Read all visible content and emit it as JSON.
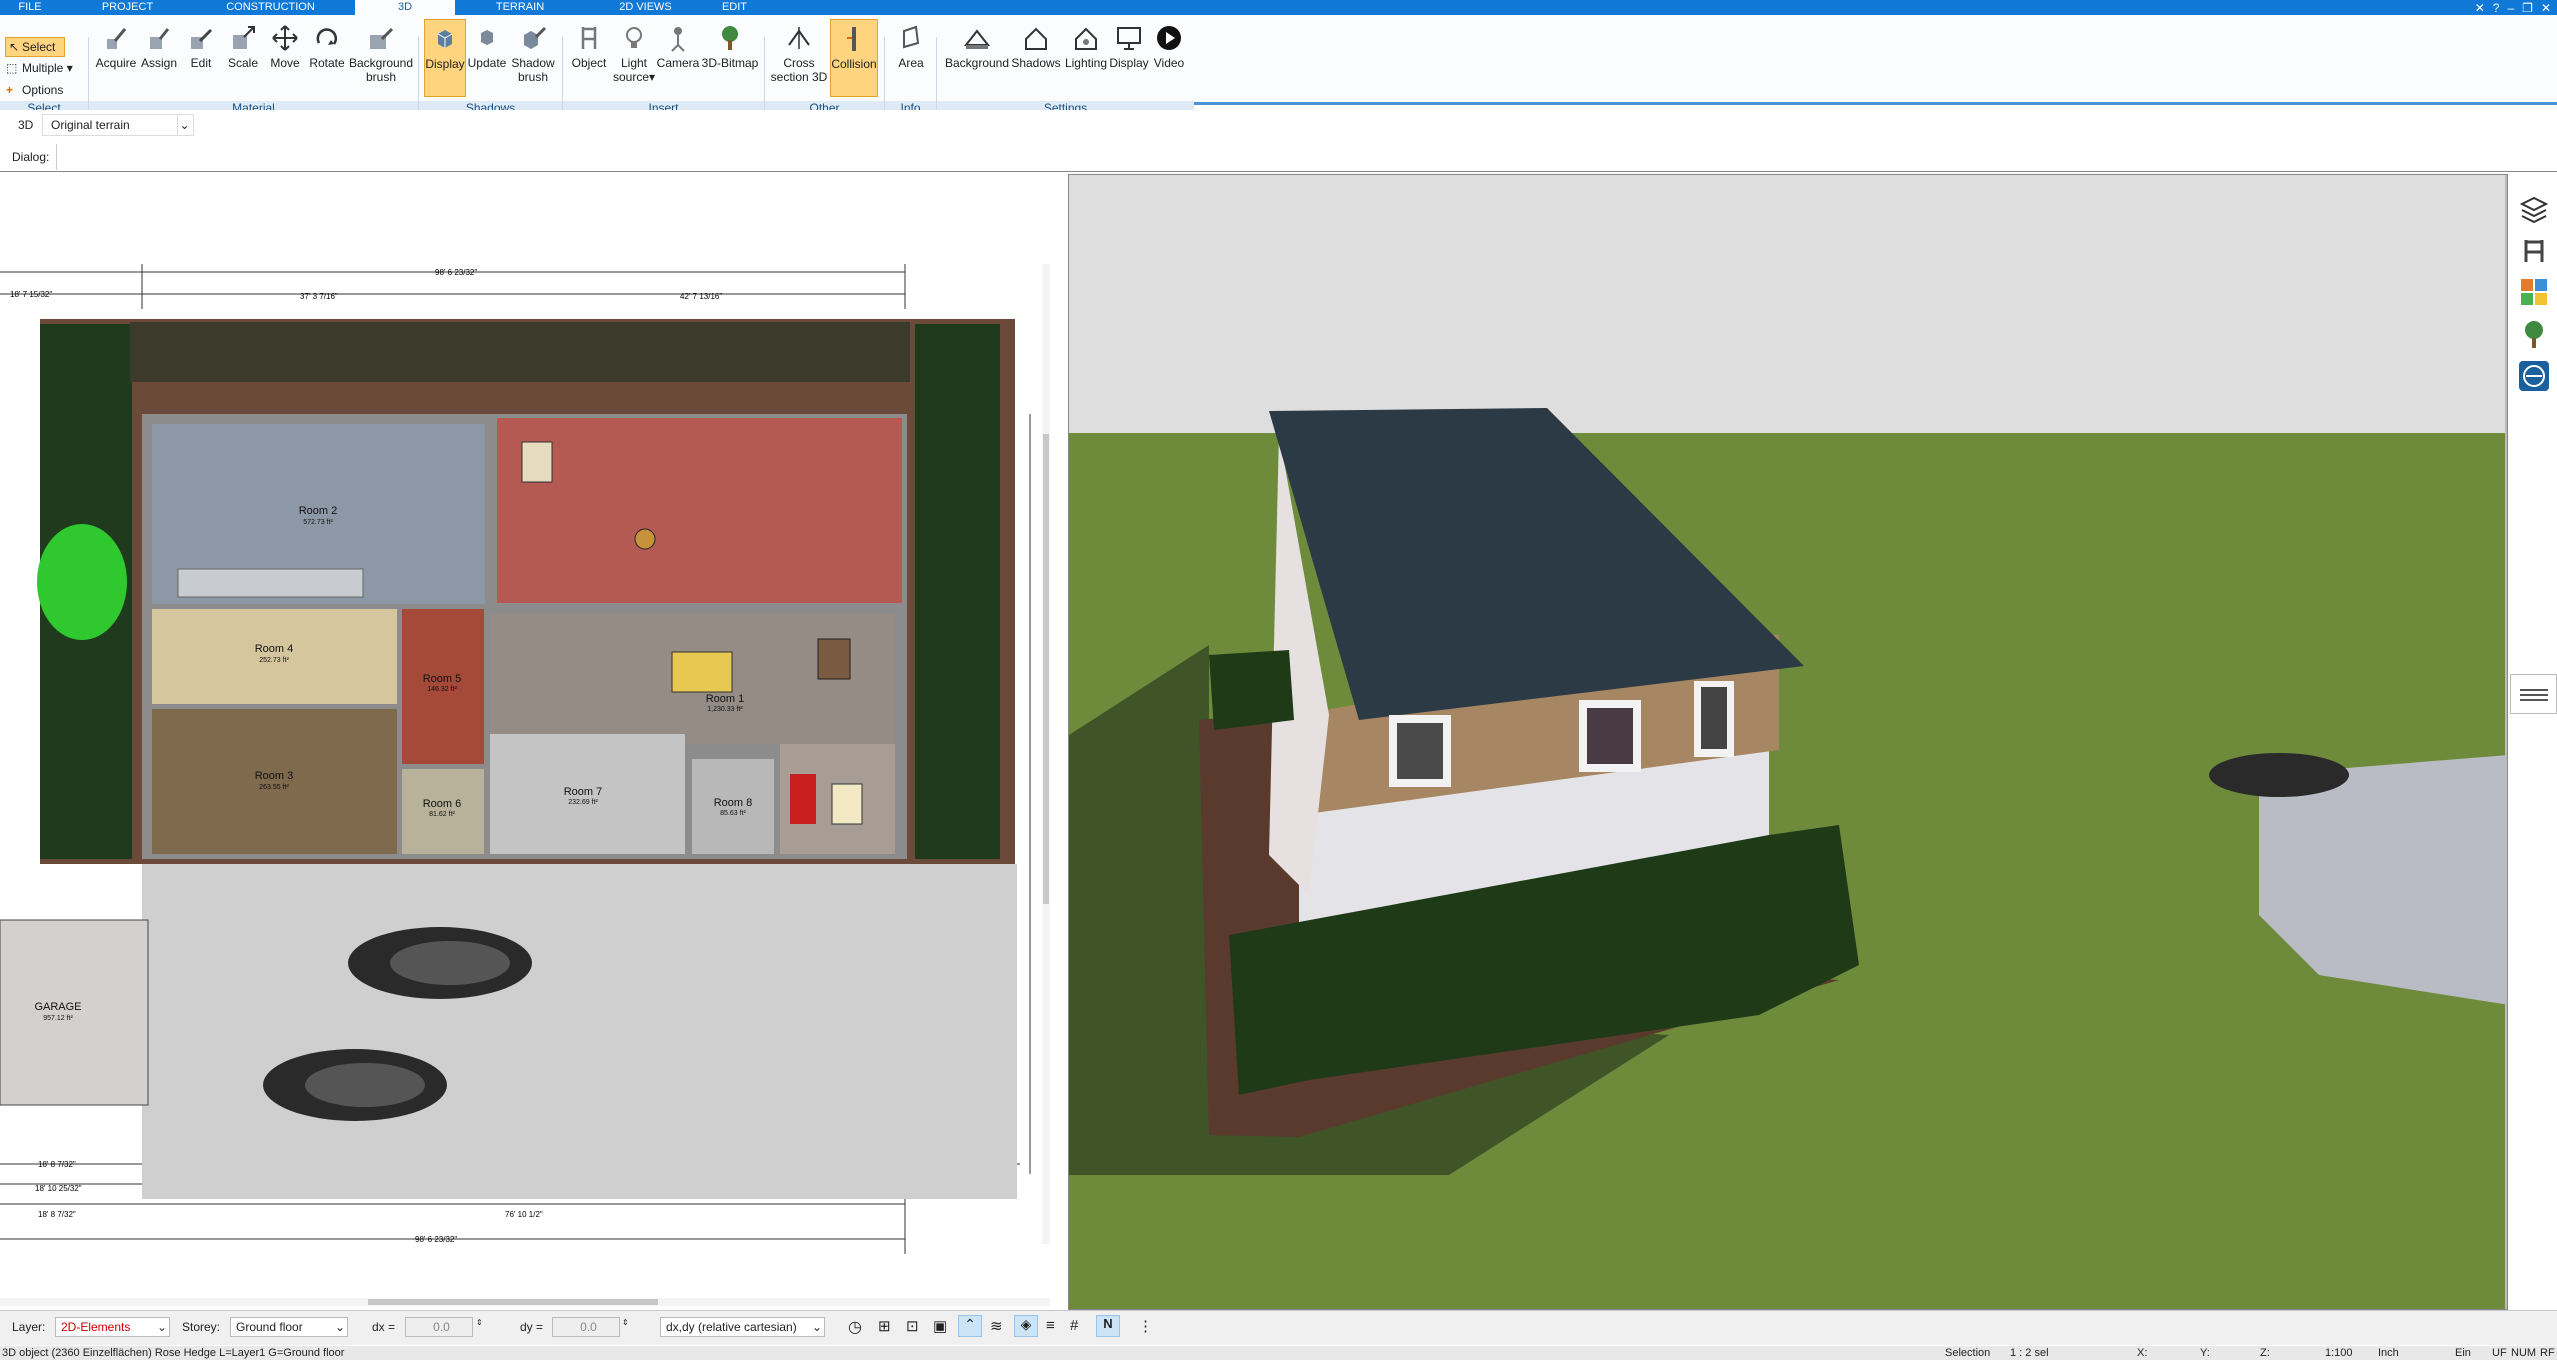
{
  "tabs": [
    "FILE",
    "PROJECT",
    "CONSTRUCTION",
    "3D",
    "TERRAIN",
    "2D VIEWS",
    "EDIT"
  ],
  "ribbon": {
    "select": {
      "select": "Select",
      "multiple": "Multiple",
      "options": "Options"
    },
    "material": {
      "acquire": "Acquire",
      "assign": "Assign",
      "edit": "Edit",
      "scale": "Scale",
      "move": "Move",
      "rotate": "Rotate",
      "bgbrush1": "Background",
      "bgbrush2": "brush"
    },
    "shadows": {
      "display": "Display",
      "update": "Update",
      "sbrush1": "Shadow",
      "sbrush2": "brush"
    },
    "insert": {
      "object": "Object",
      "light1": "Light",
      "light2": "source",
      "camera": "Camera",
      "bitmap": "3D-Bitmap"
    },
    "other": {
      "cross1": "Cross",
      "cross2": "section 3D",
      "collision": "Collision"
    },
    "info": {
      "area": "Area"
    },
    "settings": {
      "background": "Background",
      "shadows": "Shadows",
      "lighting": "Lighting",
      "display": "Display",
      "video": "Video"
    },
    "groups": {
      "select": "Select",
      "material": "Material",
      "shadows": "Shadows",
      "insert": "Insert",
      "other": "Other",
      "info": "Info",
      "settings": "Settings"
    }
  },
  "view_label": "3D",
  "terrain_select": "Original terrain",
  "dialog_label": "Dialog:",
  "plan": {
    "rooms": [
      {
        "id": "room2",
        "name": "Room 2",
        "area": "572.73 ft²"
      },
      {
        "id": "room4",
        "name": "Room 4",
        "area": "252.73 ft²"
      },
      {
        "id": "room3",
        "name": "Room 3",
        "area": "263.55 ft²"
      },
      {
        "id": "room5",
        "name": "Room 5",
        "area": "146.32 ft²"
      },
      {
        "id": "room1",
        "name": "Room 1",
        "area": "1,230.33 ft²"
      },
      {
        "id": "room6",
        "name": "Room 6",
        "area": "81.62 ft²"
      },
      {
        "id": "room7",
        "name": "Room 7",
        "area": "232.69 ft²"
      },
      {
        "id": "room8",
        "name": "Room 8",
        "area": "85.63 ft²"
      },
      {
        "id": "garage",
        "name": "GARAGE",
        "area": "957.12 ft²"
      }
    ],
    "dims": {
      "top_total": "98' 6 23/32\"",
      "top_left": "18' 7 15/32\"",
      "top_mid1": "37' 3 7/16\"",
      "top_mid2": "42' 7 13/16\"",
      "bottom_total": "98' 6 23/32\"",
      "bottom_sub": "76' 10 1/2\"",
      "left1": "18' 8 7/32\"",
      "left2": "18' 10 25/32\"",
      "left3": "18' 8 7/32\""
    }
  },
  "status": {
    "layer_label": "Layer:",
    "layer_value": "2D-Elements",
    "storey_label": "Storey:",
    "storey_value": "Ground floor",
    "dx_label": "dx =",
    "dx_value": "0.0",
    "dy_label": "dy =",
    "dy_value": "0.0",
    "mode": "dx,dy (relative cartesian)"
  },
  "info": {
    "object": "3D object (2360 Einzelflächen) Rose Hedge L=Layer1 G=Ground floor",
    "selection": "Selection",
    "sel_value": "1 : 2 sel",
    "x": "X:",
    "y": "Y:",
    "z": "Z:",
    "scale": "1:100",
    "unit": "Inch",
    "ein": "Ein",
    "uf": "UF",
    "num": "NUM",
    "rf": "RF"
  },
  "colors": {
    "accent": "#1078d6",
    "active_tool": "#ffd47e",
    "roof": "#2b3a45",
    "grass": "#6d8b3b",
    "hedge": "#1e3a17"
  }
}
